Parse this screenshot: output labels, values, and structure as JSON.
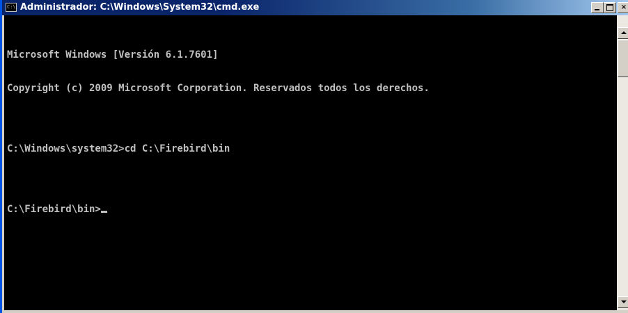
{
  "window": {
    "title": "Administrador: C:\\Windows\\System32\\cmd.exe",
    "icon": "cmd-icon",
    "icon_text": "C:\\",
    "buttons": {
      "minimize": "minimize-icon",
      "maximize": "maximize-icon",
      "close": "close-icon",
      "close_label": "×"
    }
  },
  "console": {
    "lines": [
      "Microsoft Windows [Versión 6.1.7601]",
      "Copyright (c) 2009 Microsoft Corporation. Reservados todos los derechos.",
      "",
      "C:\\Windows\\system32>cd C:\\Firebird\\bin",
      "",
      "C:\\Firebird\\bin>"
    ],
    "colors": {
      "background": "#000000",
      "foreground": "#c0c0c0"
    }
  },
  "scrollbar": {
    "up_icon": "arrow-up-icon",
    "down_icon": "arrow-down-icon"
  }
}
